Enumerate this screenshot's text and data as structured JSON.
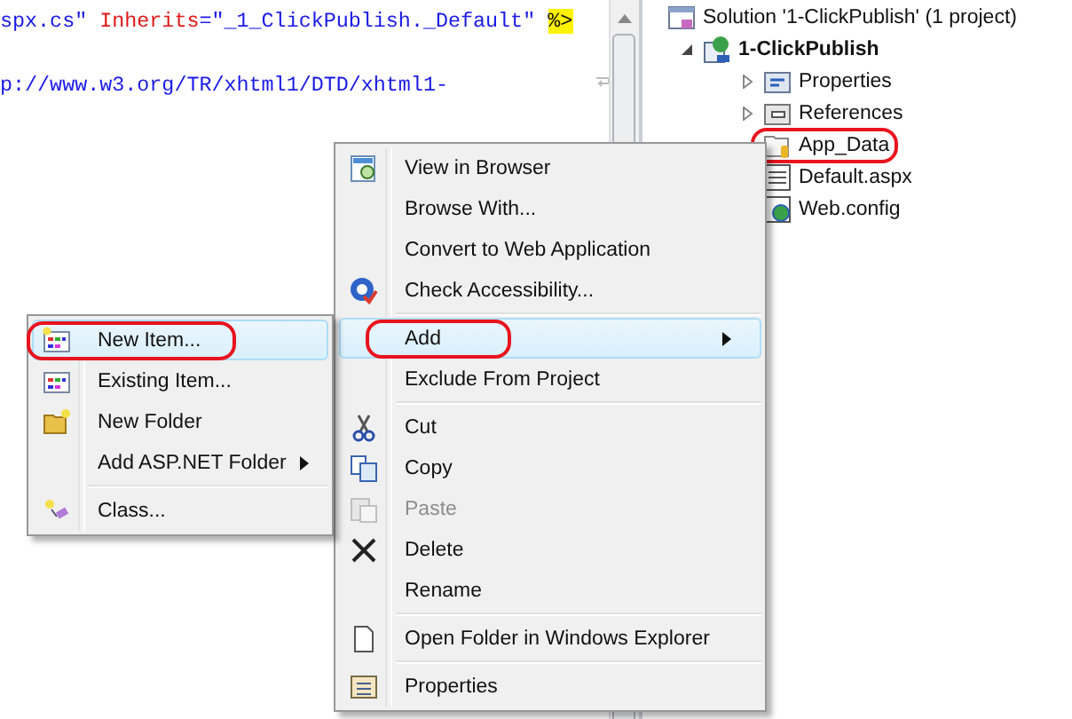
{
  "editor": {
    "lines": [
      [
        {
          "text": "spx.cs\" ",
          "kind": "value"
        },
        {
          "text": "Inherits",
          "kind": "attr"
        },
        {
          "text": "=\"_1_ClickPublish._Default\" ",
          "kind": "value"
        },
        {
          "text": "%>",
          "kind": "directive"
        }
      ],
      [
        {
          "text": "p://www.w3.org/TR/xhtml1/DTD/xhtml1-",
          "kind": "value"
        }
      ]
    ]
  },
  "solution_explorer": {
    "tree": [
      {
        "label": "Solution '1-ClickPublish' (1 project)",
        "kind": "solution",
        "children": [
          {
            "label": "1-ClickPublish",
            "kind": "project",
            "expanded": true,
            "children": [
              {
                "label": "Properties",
                "kind": "properties",
                "expanded": false
              },
              {
                "label": "References",
                "kind": "references",
                "expanded": false
              },
              {
                "label": "App_Data",
                "kind": "folder",
                "circled": true
              },
              {
                "label": "Default.aspx",
                "kind": "page"
              },
              {
                "label": "Web.config",
                "kind": "config"
              }
            ]
          }
        ]
      }
    ]
  },
  "context_menu": {
    "items": [
      {
        "kind": "item",
        "label": "View in Browser",
        "selected": false,
        "disabled": false
      },
      {
        "kind": "item",
        "label": "Browse With...",
        "selected": false,
        "disabled": false
      },
      {
        "kind": "item",
        "label": "Convert to Web Application",
        "selected": false,
        "disabled": false
      },
      {
        "kind": "item",
        "label": "Check Accessibility...",
        "selected": false,
        "disabled": false
      },
      {
        "kind": "separator"
      },
      {
        "kind": "item",
        "label": "Add",
        "selected": true,
        "disabled": false,
        "submenu": true,
        "circled": true
      },
      {
        "kind": "item",
        "label": "Exclude From Project",
        "selected": false,
        "disabled": false
      },
      {
        "kind": "separator"
      },
      {
        "kind": "item",
        "label": "Cut",
        "selected": false,
        "disabled": false
      },
      {
        "kind": "item",
        "label": "Copy",
        "selected": false,
        "disabled": false
      },
      {
        "kind": "item",
        "label": "Paste",
        "selected": false,
        "disabled": true
      },
      {
        "kind": "item",
        "label": "Delete",
        "selected": false,
        "disabled": false
      },
      {
        "kind": "item",
        "label": "Rename",
        "selected": false,
        "disabled": false
      },
      {
        "kind": "separator"
      },
      {
        "kind": "item",
        "label": "Open Folder in Windows Explorer",
        "selected": false,
        "disabled": false
      },
      {
        "kind": "separator"
      },
      {
        "kind": "item",
        "label": "Properties",
        "selected": false,
        "disabled": false
      }
    ]
  },
  "submenu": {
    "items": [
      {
        "kind": "item",
        "label": "New Item...",
        "selected": true,
        "disabled": false,
        "circled": true
      },
      {
        "kind": "item",
        "label": "Existing Item...",
        "selected": false,
        "disabled": false
      },
      {
        "kind": "item",
        "label": "New Folder",
        "selected": false,
        "disabled": false
      },
      {
        "kind": "item",
        "label": "Add ASP.NET Folder",
        "selected": false,
        "disabled": false,
        "submenu": true
      },
      {
        "kind": "separator"
      },
      {
        "kind": "item",
        "label": "Class...",
        "selected": false,
        "disabled": false
      }
    ]
  }
}
